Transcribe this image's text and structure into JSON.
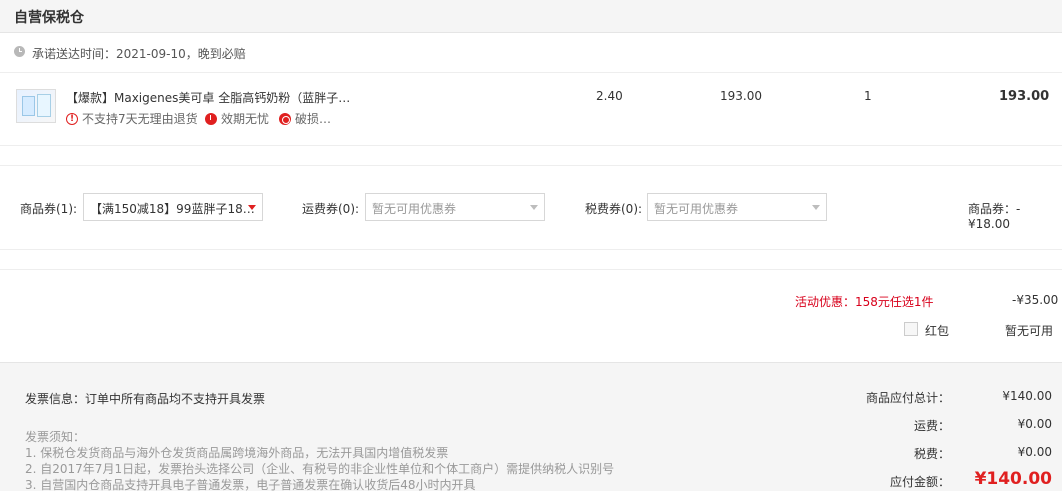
{
  "warehouse": {
    "title": "自营保税仓"
  },
  "delivery": {
    "text": "承诺送达时间：2021-09-10，晚到必赔"
  },
  "product": {
    "title": "【爆款】Maxigenes美可卓 全脂高钙奶粉（蓝胖子…",
    "tax": "2.40",
    "price": "193.00",
    "quantity": "1",
    "subtotal": "193.00",
    "tags": [
      "不支持7天无理由退货",
      "效期无忧",
      "破损…"
    ]
  },
  "coupons": {
    "product_label": "商品券(1):",
    "product_value": "【满150减18】99蓝胖子18…",
    "shipping_label": "运费券(0):",
    "shipping_value": "暂无可用优惠券",
    "tax_label": "税费券(0):",
    "tax_value": "暂无可用优惠券",
    "product_discount": "商品券：-¥18.00"
  },
  "promotion": {
    "label": "活动优惠：158元任选1件",
    "value": "-¥35.00"
  },
  "red_packet": {
    "label": "红包",
    "status": "暂无可用"
  },
  "invoice": {
    "info": "发票信息：订单中所有商品均不支持开具发票",
    "notes_title": "发票须知：",
    "notes": [
      "1. 保税仓发货商品与海外仓发货商品属跨境海外商品，无法开具国内增值税发票",
      "2. 自2017年7月1日起，发票抬头选择公司（企业、有税号的非企业性单位和个体工商户）需提供纳税人识别号",
      "3. 自营国内仓商品支持开具电子普通发票，电子普通发票在确认收货后48小时内开具"
    ]
  },
  "summary": {
    "goods_label": "商品应付总计：",
    "goods_value": "¥140.00",
    "shipping_label": "运费：",
    "shipping_value": "¥0.00",
    "tax_label": "税费：",
    "tax_value": "¥0.00",
    "total_label": "应付金额：",
    "total_value": "¥140.00"
  }
}
